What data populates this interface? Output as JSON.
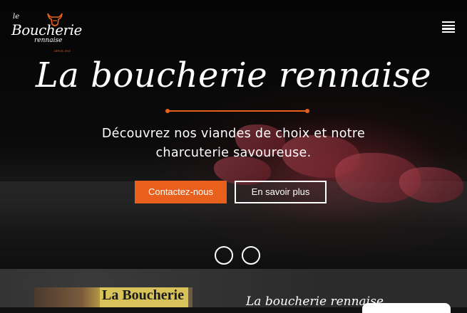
{
  "brand": {
    "logo_small": "le",
    "logo_main": "Boucherie",
    "logo_sub": "rennaise",
    "logo_tag": "DEPUIS 1950",
    "accent_color": "#e8601c"
  },
  "header": {
    "menu_icon": "hamburger-menu-icon"
  },
  "hero": {
    "title": "La boucherie rennaise",
    "subtitle": "Découvrez nos viandes de choix et notre charcuterie savoureuse.",
    "primary_button": "Contactez-nous",
    "secondary_button": "En savoir plus",
    "slider_controls": [
      "previous-slide",
      "next-slide"
    ]
  },
  "about": {
    "photo_sign": "La Boucherie",
    "title": "La boucherie rennaise"
  }
}
